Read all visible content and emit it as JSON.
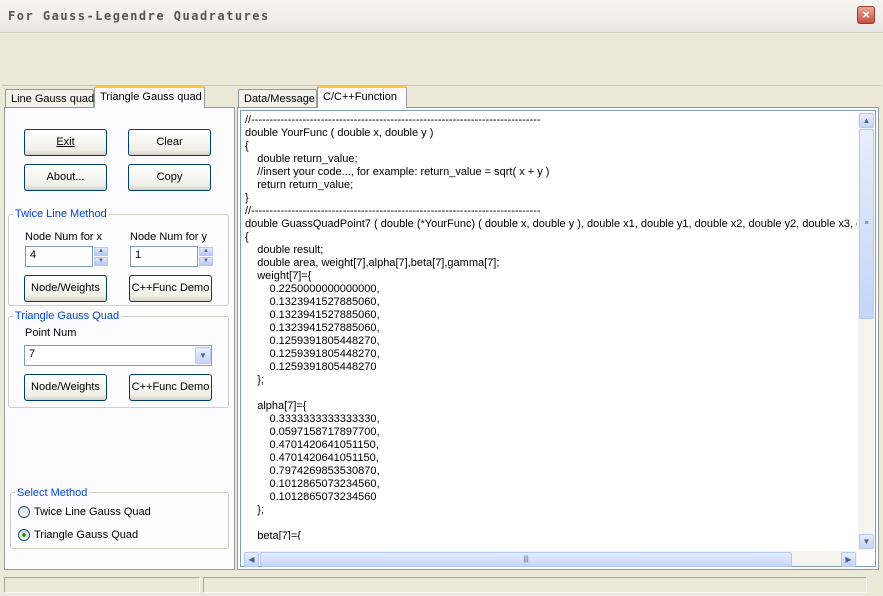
{
  "window": {
    "title": "For Gauss-Legendre Quadratures",
    "close_glyph": "×"
  },
  "left_tabs": [
    {
      "label": "Line Gauss quad",
      "active": false
    },
    {
      "label": "Triangle Gauss quad",
      "active": true
    }
  ],
  "buttons": {
    "exit": "Exit",
    "clear": "Clear",
    "about": "About...",
    "copy": "Copy"
  },
  "twice_line": {
    "title": "Twice Line Method",
    "x_label": "Node Num for x",
    "x_value": "4",
    "y_label": "Node Num for y",
    "y_value": "1",
    "node_weights": "Node/Weights",
    "func_demo": "C++Func Demo"
  },
  "triangle_quad": {
    "title": "Triangle Gauss Quad",
    "point_label": "Point Num",
    "point_value": "7",
    "node_weights": "Node/Weights",
    "func_demo": "C++Func Demo"
  },
  "select_method": {
    "title": "Select Method",
    "options": [
      {
        "label": "Twice Line Gauss Quad",
        "checked": false
      },
      {
        "label": "Triangle Gauss Quad",
        "checked": true
      }
    ]
  },
  "right_tabs": [
    {
      "label": "Data/Message",
      "active": false
    },
    {
      "label": "C/C++Function",
      "active": true
    }
  ],
  "code_lines": [
    "//-------------------------------------------------------------------------------",
    "double YourFunc ( double x, double y )",
    "{",
    "    double return_value;",
    "    //insert your code..., for example: return_value = sqrt( x + y )",
    "    return return_value;",
    "}",
    "//-------------------------------------------------------------------------------",
    "double GuassQuadPoint7 ( double (*YourFunc) ( double x, double y ), double x1, double y1, double x2, double y2, double x3, d",
    "{",
    "    double result;",
    "    double area, weight[7],alpha[7],beta[7],gamma[7];",
    "    weight[7]={",
    "        0.2250000000000000,",
    "        0.1323941527885060,",
    "        0.1323941527885060,",
    "        0.1323941527885060,",
    "        0.1259391805448270,",
    "        0.1259391805448270,",
    "        0.1259391805448270",
    "    };",
    "",
    "    alpha[7]={",
    "        0.3333333333333330,",
    "        0.0597158717897700,",
    "        0.4701420641051150,",
    "        0.4701420641051150,",
    "        0.7974269853530870,",
    "        0.1012865073234560,",
    "        0.1012865073234560",
    "    };",
    "",
    "    beta[7]={"
  ],
  "scroll": {
    "up": "▲",
    "down": "▼",
    "left": "◀",
    "right": "▶",
    "dropdown": "▼",
    "spin_up": "▲",
    "spin_down": "▼"
  }
}
